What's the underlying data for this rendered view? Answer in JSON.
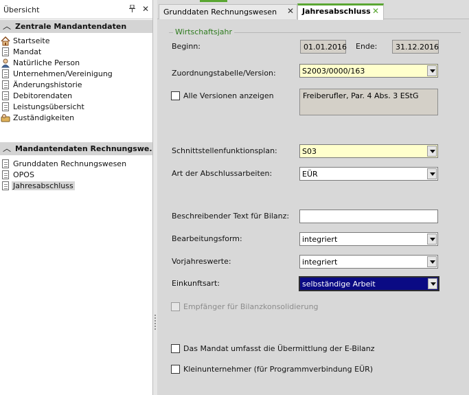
{
  "sidebar": {
    "title": "Übersicht",
    "pin_icon": "pin-icon",
    "close_icon": "close-icon",
    "sections": [
      {
        "title": "Zentrale Mandantendaten",
        "items": [
          {
            "label": "Startseite",
            "icon": "house-icon"
          },
          {
            "label": "Mandat",
            "icon": "mandate-document-icon"
          },
          {
            "label": "Natürliche Person",
            "icon": "person-icon"
          },
          {
            "label": "Unternehmen/Vereinigung",
            "icon": "company-document-icon"
          },
          {
            "label": "Änderungshistorie",
            "icon": "history-document-icon"
          },
          {
            "label": "Debitorendaten",
            "icon": "debtor-document-icon"
          },
          {
            "label": "Leistungsübersicht",
            "icon": "services-document-icon"
          },
          {
            "label": "Zuständigkeiten",
            "icon": "responsibility-icon"
          }
        ]
      },
      {
        "title": "Mandantendaten Rechnungswe...",
        "items": [
          {
            "label": "Grunddaten Rechnungswesen",
            "icon": "document-icon"
          },
          {
            "label": "OPOS",
            "icon": "document-icon"
          },
          {
            "label": "Jahresabschluss",
            "icon": "document-icon",
            "selected": true
          }
        ]
      }
    ]
  },
  "tabs": [
    {
      "label": "Grunddaten Rechnungswesen",
      "active": false
    },
    {
      "label": "Jahresabschluss",
      "active": true
    }
  ],
  "form": {
    "group_title": "Wirtschaftsjahr",
    "beginn_label": "Beginn:",
    "beginn_value": "01.01.2016",
    "ende_label": "Ende:",
    "ende_value": "31.12.2016",
    "zuordnung_label": "Zuordnungstabelle/Version:",
    "zuordnung_value": "S2003/0000/163",
    "alle_versionen_label": "Alle Versionen anzeigen",
    "alle_versionen_checked": false,
    "version_description": "Freiberufler, Par. 4 Abs. 3 EStG",
    "schnittstellen_label": "Schnittstellenfunktionsplan:",
    "schnittstellen_value": "S03",
    "art_label": "Art der Abschlussarbeiten:",
    "art_value": "EÜR",
    "beschreibender_label": "Beschreibender Text für Bilanz:",
    "beschreibender_value": "",
    "bearbeitungsform_label": "Bearbeitungsform:",
    "bearbeitungsform_value": "integriert",
    "vorjahreswerte_label": "Vorjahreswerte:",
    "vorjahreswerte_value": "integriert",
    "einkunftsart_label": "Einkunftsart:",
    "einkunftsart_value": "selbständige Arbeit",
    "empfaenger_label": "Empfänger für Bilanzkonsolidierung",
    "empfaenger_checked": false,
    "ebilanz_label": "Das Mandat umfasst die Übermittlung der E-Bilanz",
    "ebilanz_checked": false,
    "kleinunternehmer_label": "Kleinunternehmer (für Programmverbindung EÜR)",
    "kleinunternehmer_checked": false
  },
  "colors": {
    "accent_green": "#5aa632",
    "required_field": "#ffffcc",
    "selection_blue": "#0a0a84",
    "readonly_gray": "#d4d0c8"
  }
}
